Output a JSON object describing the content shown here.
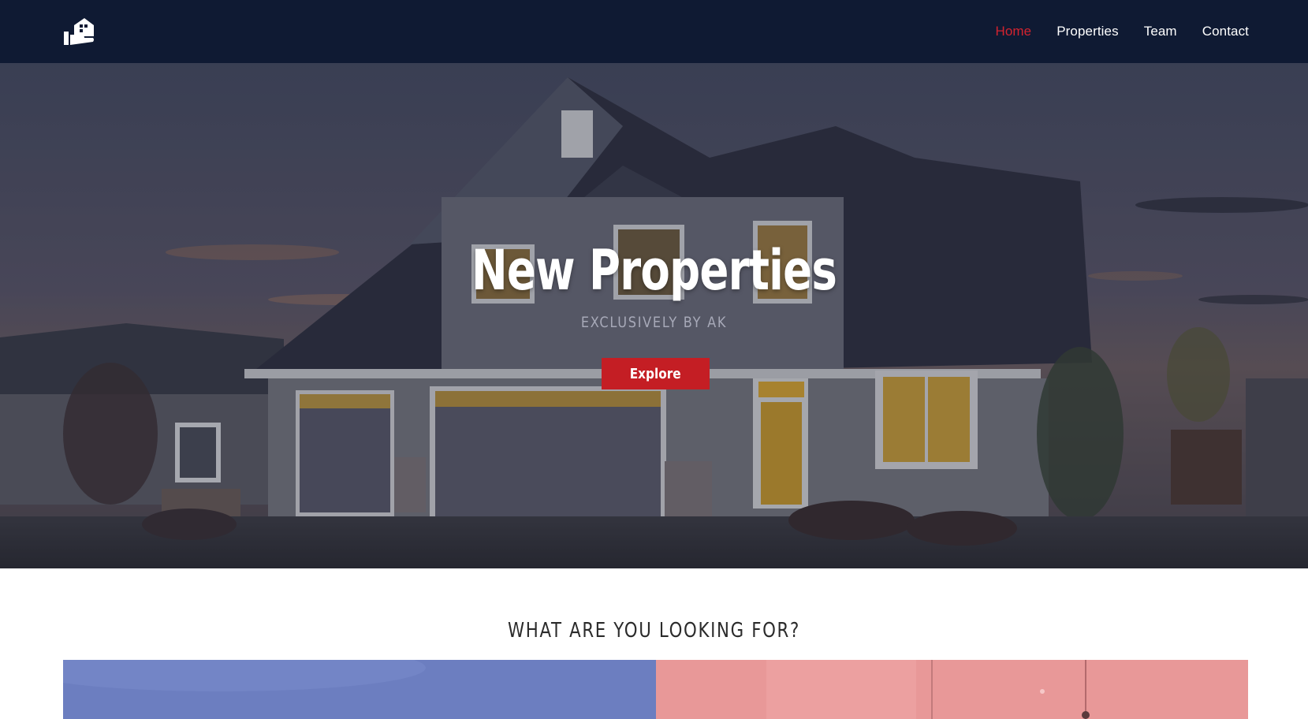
{
  "navbar": {
    "logo_icon": "house-hand-logo-icon",
    "links": [
      {
        "label": "Home",
        "active": true
      },
      {
        "label": "Properties",
        "active": false
      },
      {
        "label": "Team",
        "active": false
      },
      {
        "label": "Contact",
        "active": false
      }
    ]
  },
  "hero": {
    "title": "New Properties",
    "subtitle": "EXCLUSIVELY BY AK",
    "cta_label": "Explore",
    "image_subject": "suburban-house-at-dusk"
  },
  "section": {
    "title": "WHAT ARE YOU LOOKING FOR?",
    "cards": [
      {
        "name": "category-card-exterior",
        "tint": "#6d7fc1"
      },
      {
        "name": "category-card-interior",
        "tint": "#e89a9a"
      }
    ]
  },
  "colors": {
    "navbar_bg": "#0f1a33",
    "accent": "#c41e24",
    "active_link": "#d3232f"
  }
}
